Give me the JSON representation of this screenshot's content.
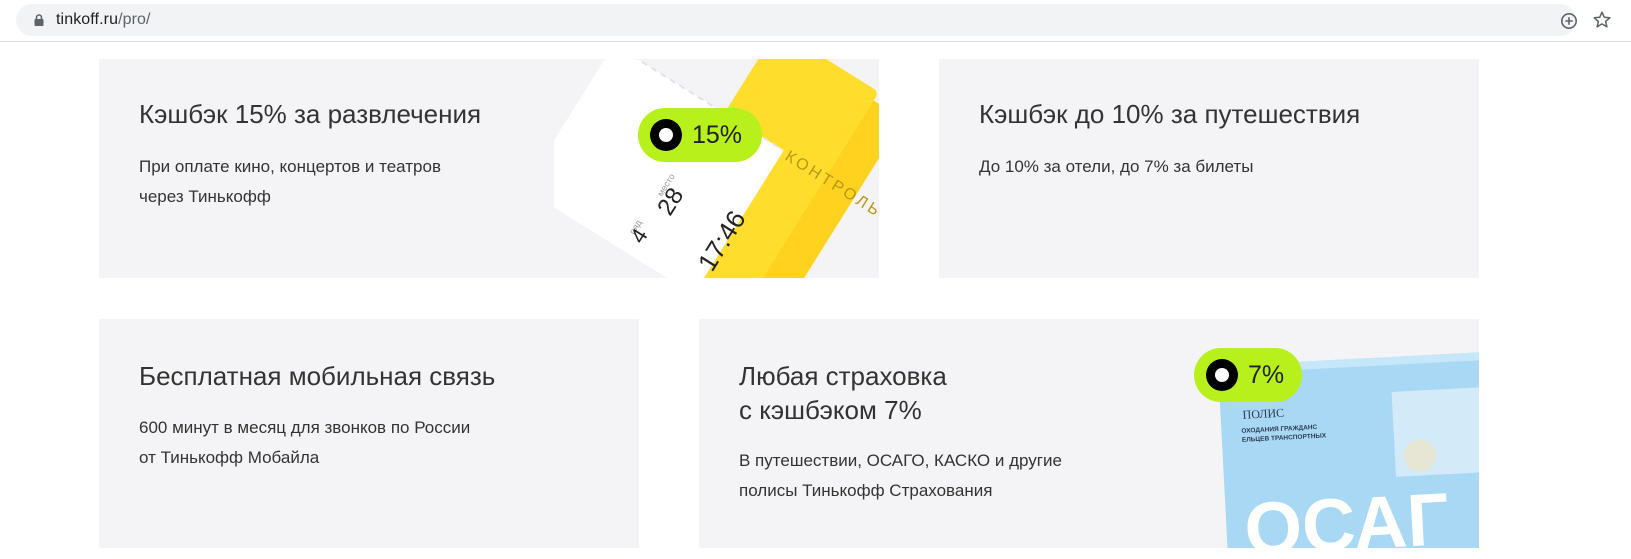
{
  "browser": {
    "url_host": "tinkoff.ru",
    "url_path": "/pro/"
  },
  "cards": {
    "entertainment": {
      "title": "Кэшбэк 15% за развлечения",
      "text_line1": "При оплате кино, концертов и театров",
      "text_line2": "через Тинькофф",
      "badge": "15%",
      "ticket": {
        "row_label": "ряд",
        "row": "4",
        "seat_label": "место",
        "seat": "28",
        "time": "17:46",
        "stub": "КОНТРОЛЬ"
      }
    },
    "travel": {
      "title": "Кэшбэк до 10% за путешествия",
      "text": "До 10% за отели, до 7% за билеты"
    },
    "mobile": {
      "title": "Бесплатная мобильная связь",
      "text_line1": "600 минут в месяц для звонков по России",
      "text_line2": "от Тинькофф Мобайла"
    },
    "insurance": {
      "title_line1": "Любая страховка",
      "title_line2": "с кэшбэком 7%",
      "text_line1": "В путешествии, ОСАГО, КАСКО и другие",
      "text_line2": "полисы Тинькофф Страхования",
      "badge": "7%",
      "policy": {
        "heading": "ПОЛИС",
        "line1": "ОХОДАНИЯ ГРАЖДАНС",
        "line2": "ЕЛЬЦЕВ ТРАНСПОРТНЫХ",
        "big": "ОСАГ"
      }
    }
  },
  "colors": {
    "card_bg": "#f4f4f6",
    "badge": "#b7f01b",
    "ticket_yellow": "#ffdd2d",
    "policy_blue": "#a8d8f4"
  },
  "icons": [
    "lock-icon",
    "add-icon",
    "star-icon",
    "badge-dot-icon"
  ]
}
